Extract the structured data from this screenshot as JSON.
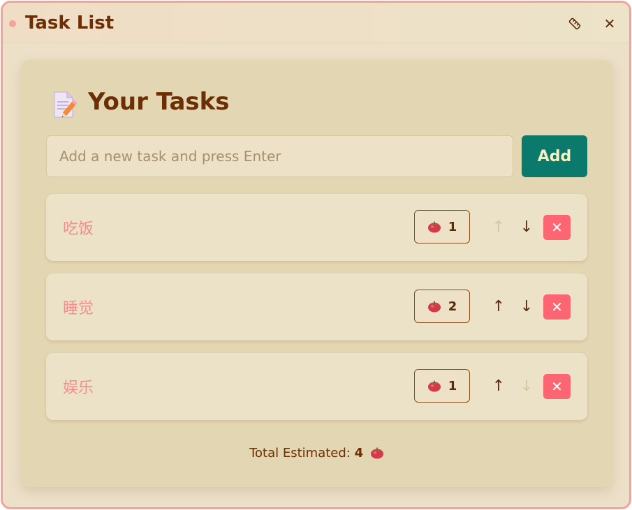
{
  "window": {
    "title": "Task List",
    "ruler_icon": "ruler-icon",
    "close_icon": "close-icon",
    "close_glyph": "✕"
  },
  "main": {
    "heading": "Your Tasks",
    "heading_icon": "memo-icon",
    "input_placeholder": "Add a new task and press Enter",
    "input_value": "",
    "add_label": "Add"
  },
  "tasks": [
    {
      "name": "吃饭",
      "pomodoros": "1",
      "up_enabled": false,
      "down_enabled": true
    },
    {
      "name": "睡觉",
      "pomodoros": "2",
      "up_enabled": true,
      "down_enabled": true
    },
    {
      "name": "娱乐",
      "pomodoros": "1",
      "up_enabled": true,
      "down_enabled": false
    }
  ],
  "controls": {
    "up_glyph": "↑",
    "down_glyph": "↓",
    "delete_glyph": "✕"
  },
  "footer": {
    "total_label": "Total Estimated:",
    "total_value": "4"
  },
  "colors": {
    "accent": "#0b7a6d",
    "danger": "#fb6672",
    "title_text": "#6b2e05",
    "task_text": "#f08f8f",
    "window_border": "#f4a39b"
  }
}
